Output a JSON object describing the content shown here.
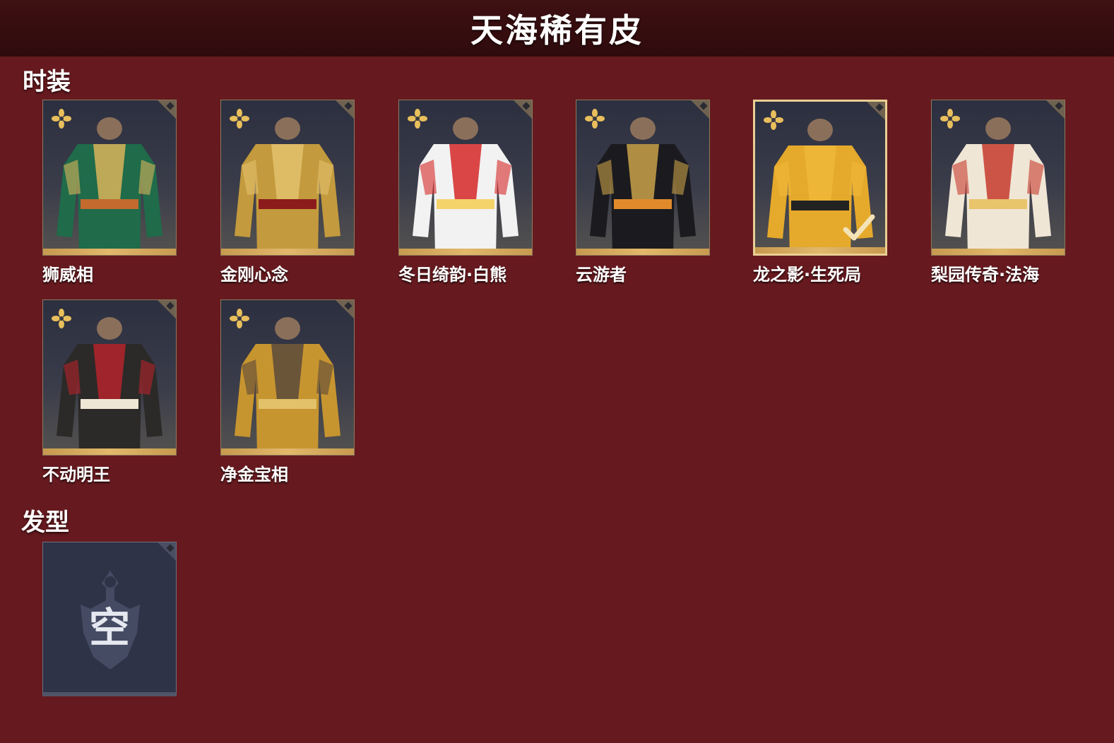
{
  "header": {
    "title": "天海稀有皮"
  },
  "sections": {
    "outfits": {
      "title": "时装"
    },
    "hairstyles": {
      "title": "发型"
    }
  },
  "outfits": [
    {
      "name": "狮威相",
      "selected": false,
      "palette": [
        "#1f6b4a",
        "#d9b45a",
        "#c46a2e"
      ]
    },
    {
      "name": "金刚心念",
      "selected": false,
      "palette": [
        "#c39a3d",
        "#e3c26c",
        "#8c1b1b"
      ]
    },
    {
      "name": "冬日绮韵·白熊",
      "selected": false,
      "palette": [
        "#f2f2f2",
        "#d62828",
        "#f5d36b"
      ]
    },
    {
      "name": "云游者",
      "selected": false,
      "palette": [
        "#1b1b1f",
        "#c9a24a",
        "#e08a2b"
      ]
    },
    {
      "name": "龙之影·生死局",
      "selected": true,
      "palette": [
        "#e5a92b",
        "#f0b93a",
        "#222222"
      ]
    },
    {
      "name": "梨园传奇·法海",
      "selected": false,
      "palette": [
        "#f0e6d6",
        "#c63a2d",
        "#e8c46b"
      ]
    },
    {
      "name": "不动明王",
      "selected": false,
      "palette": [
        "#2c2a28",
        "#b5232b",
        "#efe7d5"
      ]
    },
    {
      "name": "净金宝相",
      "selected": false,
      "palette": [
        "#c7952f",
        "#5a4a3b",
        "#e2c16a"
      ]
    }
  ],
  "hairstyle_slot": {
    "label": "空"
  },
  "colors": {
    "background": "#661a1f",
    "header": "#2f0b0d",
    "card_gold": "#d9ad62",
    "empty_card": "#2e3348"
  },
  "icons": {
    "rarity_badge": "gold-flower-icon",
    "selected_mark": "checkmark-icon",
    "empty_emblem": "sword-emblem-icon"
  }
}
